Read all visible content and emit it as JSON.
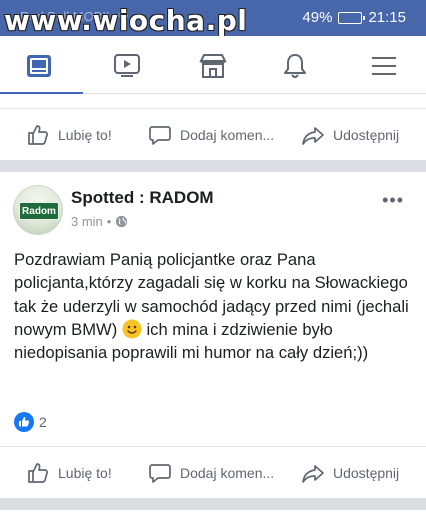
{
  "watermark": "www.wiocha.pl",
  "status": {
    "carrier": "Red Bull MOBIL ⁴ᴳ",
    "battery": "49%",
    "time": "21:15",
    "battery_level": 0.49
  },
  "nav": {
    "icons": [
      "news-feed-icon",
      "video-icon",
      "marketplace-icon",
      "notifications-icon",
      "menu-icon"
    ],
    "active_index": 0
  },
  "prev_post": {
    "actions": {
      "like": "Lubię to!",
      "comment": "Dodaj komen...",
      "share": "Udostępnij"
    }
  },
  "post": {
    "author": "Spotted : RADOM",
    "avatar_text": "Radom",
    "time": "3 min",
    "privacy_icon": "globe-icon",
    "text_part1": "Pozdrawiam Panią policjantke oraz Pana policjanta,którzy zagadali się w korku na Słowackiego tak że uderzyli w samochód jadący przed nimi (jechali nowym BMW) ",
    "text_part2": " ich mina i zdziwienie było niedopisania poprawili mi humor na cały dzień;))",
    "reactions_count": "2",
    "actions": {
      "like": "Lubię to!",
      "comment": "Dodaj komen...",
      "share": "Udostępnij"
    }
  },
  "colors": {
    "brand": "#4867aa",
    "active_tab": "#4267b2",
    "like_blue": "#1877f2",
    "divider": "#dadde1"
  }
}
